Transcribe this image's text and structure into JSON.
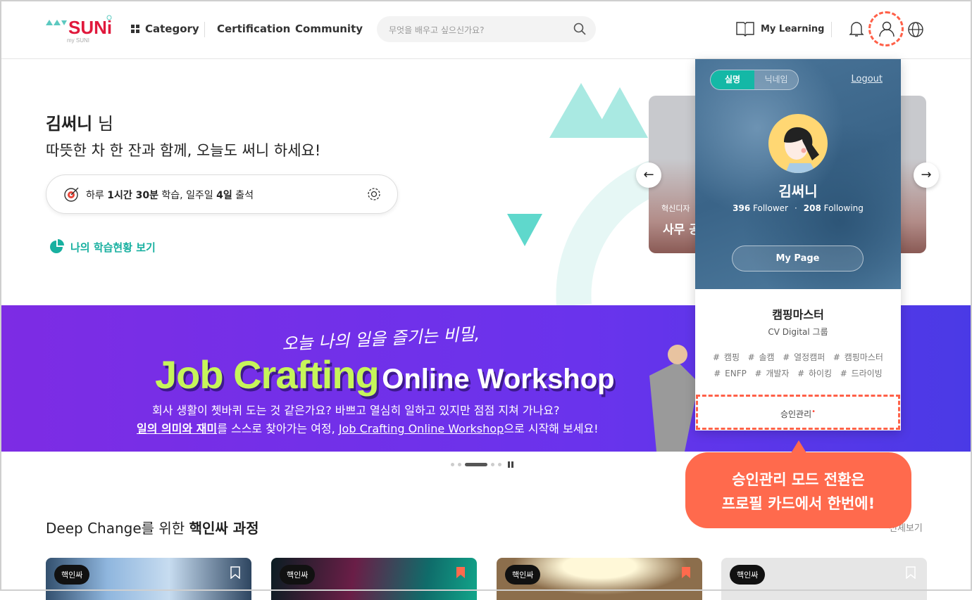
{
  "header": {
    "logo_text": "SUNi",
    "logo_sub": "my SUNI",
    "nav": [
      "Category",
      "Certification",
      "Community"
    ],
    "search_placeholder": "무엇을 배우고 싶으신가요?",
    "my_learning": "My Learning"
  },
  "hero": {
    "name": "김써니",
    "honorific": " 님",
    "subtitle": "따뜻한 차 한 잔과 함께, 오늘도 써니 하세요!",
    "goal": {
      "p1": "하루 ",
      "p2": "1시간 30분",
      "p3": " 학습, 일주일 ",
      "p4": "4일",
      "p5": " 출석"
    },
    "status_link": "나의 학습현황 보기"
  },
  "carousel": {
    "category": "혁신디자",
    "title": "사무 공"
  },
  "banner": {
    "script": "오늘 나의 일을 즐기는 비밀,",
    "title_a": "Job Crafting",
    "title_b": "Online Workshop",
    "line1": "회사 생활이 쳇바퀴 도는 것 같은가요? 바쁘고 열심히 일하고 있지만 점점 지쳐 가나요?",
    "line2_u1": "일의 의미와 재미",
    "line2_a": "를 스스로 찾아가는 여정, ",
    "line2_u2": "Job Crafting Online Workshop",
    "line2_b": "으로 시작해 보세요!"
  },
  "section": {
    "title_a": "Deep Change를 위한 ",
    "title_b": "핵인싸 과정",
    "view_all": "전체보기",
    "cards": [
      {
        "tag": "핵인싸",
        "bookmarked": false
      },
      {
        "tag": "핵인싸",
        "bookmarked": true
      },
      {
        "tag": "핵인싸",
        "bookmarked": true
      },
      {
        "tag": "핵인싸",
        "bookmarked": false
      }
    ]
  },
  "profile": {
    "toggle": [
      "실명",
      "닉네임"
    ],
    "logout": "Logout",
    "name": "김써니",
    "followers": "396",
    "follower_label": " Follower",
    "following": "208",
    "following_label": " Following",
    "my_page": "My Page",
    "nickname": "캠핑마스터",
    "group": "CV Digital 그룹",
    "tags1": "# 캠핑  # 솔캠  # 열정캠퍼  # 캠핑마스터",
    "tags2": "# ENFP  # 개발자  # 하이킹  # 드라이빙",
    "approve": "승인관리"
  },
  "tooltip": {
    "line1": "승인관리 모드 전환은",
    "line2": "프로필 카드에서 한번에!"
  },
  "colors": {
    "accent": "#ff6a4d",
    "teal": "#14b8a6",
    "banner": "#7d2ce4"
  }
}
